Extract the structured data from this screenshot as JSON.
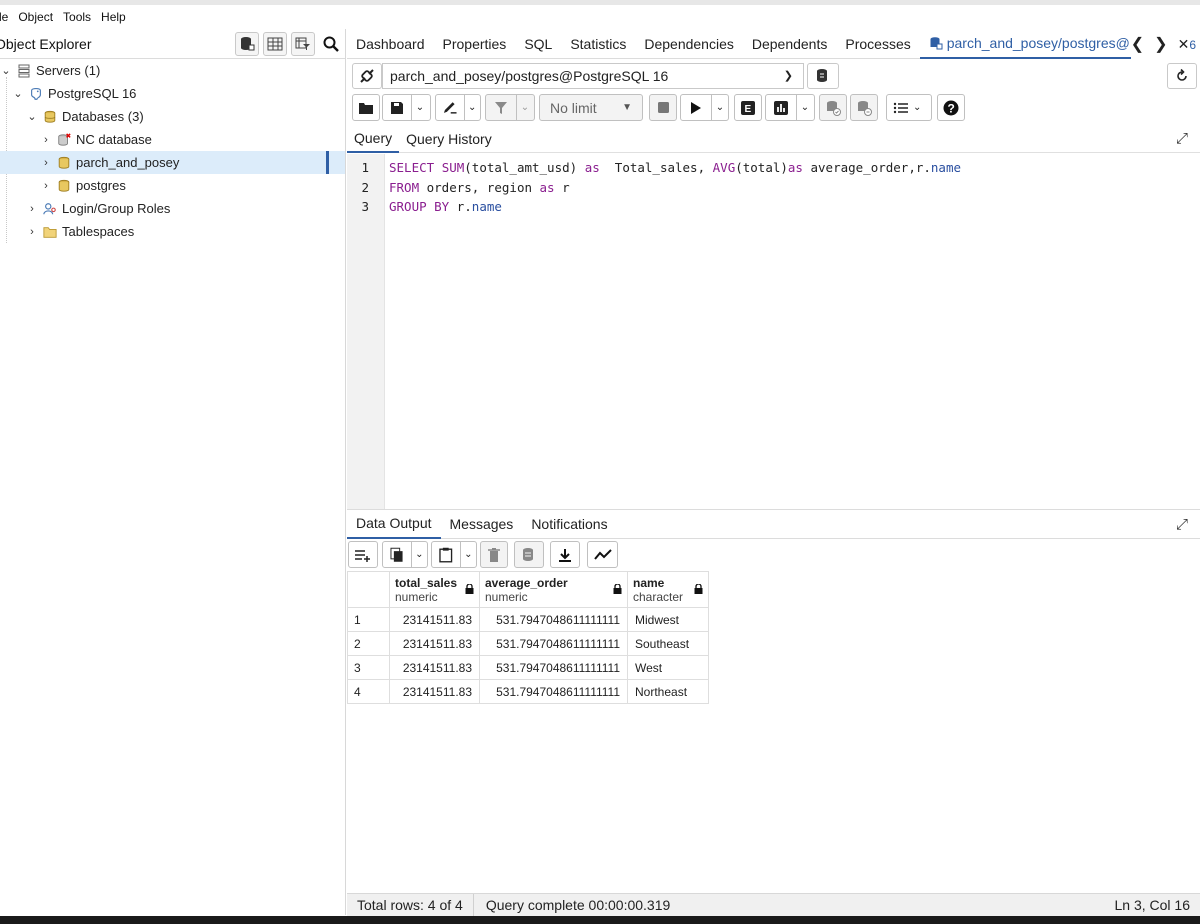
{
  "menu": [
    "le",
    "Object",
    "Tools",
    "Help"
  ],
  "object_explorer": {
    "title": "Object Explorer",
    "tree": {
      "servers": "Servers (1)",
      "server": "PostgreSQL 16",
      "databases": "Databases (3)",
      "db_items": [
        "NC database",
        "parch_and_posey",
        "postgres"
      ],
      "login_roles": "Login/Group Roles",
      "tablespaces": "Tablespaces"
    }
  },
  "tabs": [
    "Dashboard",
    "Properties",
    "SQL",
    "Statistics",
    "Dependencies",
    "Dependents",
    "Processes"
  ],
  "active_tab": "parch_and_posey/postgres@Pc",
  "tab_overflow": "6",
  "connection": "parch_and_posey/postgres@PostgreSQL 16",
  "limit": "No limit",
  "query_tabs": [
    "Query",
    "Query History"
  ],
  "editor": {
    "line_numbers": [
      "1",
      "2",
      "3"
    ]
  },
  "result_tabs": [
    "Data Output",
    "Messages",
    "Notifications"
  ],
  "columns": [
    {
      "name": "total_sales",
      "type": "numeric"
    },
    {
      "name": "average_order",
      "type": "numeric"
    },
    {
      "name": "name",
      "type": "character"
    }
  ],
  "rows": [
    [
      "1",
      "23141511.83",
      "531.7947048611111111",
      "Midwest"
    ],
    [
      "2",
      "23141511.83",
      "531.7947048611111111",
      "Southeast"
    ],
    [
      "3",
      "23141511.83",
      "531.7947048611111111",
      "West"
    ],
    [
      "4",
      "23141511.83",
      "531.7947048611111111",
      "Northeast"
    ]
  ],
  "status": {
    "rows": "Total rows: 4 of 4",
    "query": "Query complete 00:00:00.319",
    "cursor": "Ln 3, Col 16"
  },
  "colors": {
    "accent": "#2f5fa5",
    "keyword": "#8a1e8f",
    "selected_bg": "#dcecfa"
  }
}
